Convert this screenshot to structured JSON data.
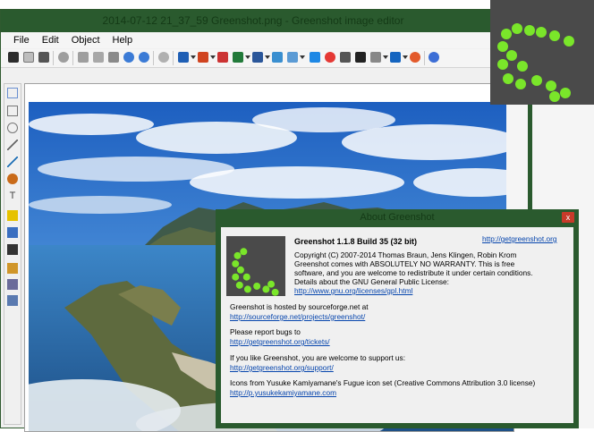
{
  "editor": {
    "title": "2014-07-12 21_37_59 Greenshot.png - Greenshot image editor",
    "menu": [
      "File",
      "Edit",
      "Object",
      "Help"
    ]
  },
  "about": {
    "title": "About Greenshot",
    "close_label": "x",
    "app_title": "Greenshot 1.1.8 Build 35 (32 bit)",
    "website_link": "http://getgreenshot.org",
    "copyright": "Copyright (C) 2007-2014 Thomas Braun, Jens Klingen, Robin Krom",
    "license_line1": "Greenshot comes with ABSOLUTELY NO WARRANTY. This is free",
    "license_line2": "software, and you are welcome to redistribute it under certain conditions.",
    "license_line3": "Details about the GNU General Public License:",
    "license_link": "http://www.gnu.org/licenses/gpl.html",
    "hosted_text": "Greenshot is hosted by sourceforge.net at",
    "hosted_link": "http://sourceforge.net/projects/greenshot/",
    "bugs_text": "Please report bugs to",
    "bugs_link": "http://getgreenshot.org/tickets/",
    "support_text": "If you like Greenshot, you are welcome to support us:",
    "support_link": "http://getgreenshot.org/support/",
    "icons_text": "Icons from Yusuke Kamiyamane's Fugue icon set (Creative Commons Attribution 3.0 license)",
    "icons_link": "http://p.yusukekamiyamane.com"
  },
  "colors": {
    "window_green": "#2a5a2e",
    "logo_dark": "#4a4a4a",
    "logo_dots": "#7ae62a",
    "link": "#0645ad",
    "close_red": "#c83a2a"
  }
}
